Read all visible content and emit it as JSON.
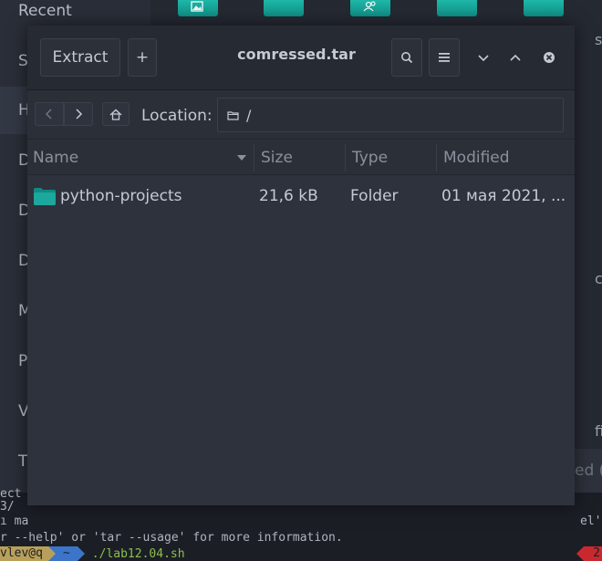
{
  "background": {
    "sidebar_items": [
      "Recent",
      "S",
      "H",
      "D",
      "D",
      "D",
      "M",
      "P",
      "V",
      "T"
    ],
    "right_letters": [
      "s",
      "c",
      "fi"
    ],
    "right_partial_text": "ed ("
  },
  "terminal": {
    "lines": [
      "ect",
      "3/",
      "ı ma",
      "r --help' or 'tar --usage' for more information."
    ],
    "partial_right": "el'",
    "prompt_user": "vlev@q",
    "prompt_dir": "~",
    "prompt_cmd": "./lab12.04.sh",
    "error_count": "2"
  },
  "window": {
    "title": "comressed.tar",
    "extract_label": "Extract",
    "add_label": "+",
    "location_label": "Location:",
    "location_path": "/",
    "columns": [
      "Name",
      "Size",
      "Type",
      "Modified"
    ],
    "rows": [
      {
        "name": "python-projects",
        "size": "21,6 kB",
        "type": "Folder",
        "modified": "01  мая 2021,  ..."
      }
    ]
  },
  "colors": {
    "folder": "#1ca89c",
    "window_bg": "#2e323c",
    "headerbar_bg": "#262a33"
  }
}
